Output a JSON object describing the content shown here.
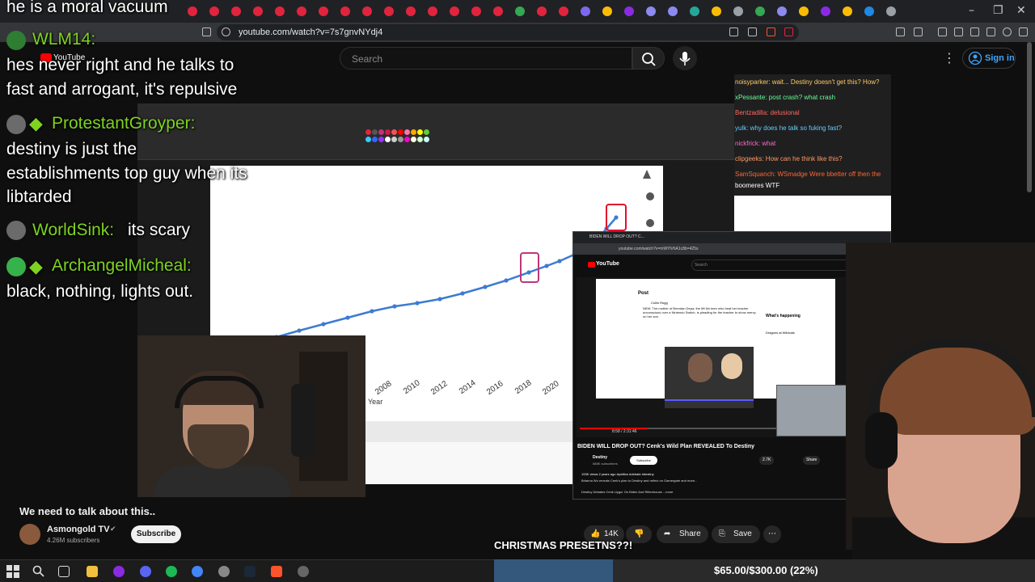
{
  "browser": {
    "url": "youtube.com/watch?v=7s7gnvNYdj4"
  },
  "youtube_header": {
    "search_placeholder": "Search",
    "sign_in": "Sign in",
    "logo_text": "YouTube"
  },
  "stream_chat": {
    "top_caption": "he is a moral vacuum",
    "messages": [
      {
        "user": "WLM14:",
        "lines": [
          "hes never right and he talks to",
          "fast and arrogant, it's repulsive"
        ]
      },
      {
        "user": "ProtestantGroyper:",
        "lines": [
          "destiny is just the",
          "establishments top guy when its",
          "libtarded"
        ]
      },
      {
        "user": "WorldSink:",
        "lines": [
          "its scary"
        ]
      },
      {
        "user": "ArchangelMicheal:",
        "lines": [
          "black, nothing, lights out."
        ]
      }
    ]
  },
  "chart_panel": {
    "x_ticks": [
      "2008",
      "2010",
      "2012",
      "2014",
      "2016",
      "2018",
      "2020"
    ],
    "x_label": "Year"
  },
  "overlay_chat": {
    "lines": [
      "noisyparker: wait... Destiny doesn't get this? How?",
      "xPessante: post crash? what crash",
      "Bentzadilla: delusional",
      "yulk: why does he talk so fuking fast?",
      "nickfrick: what",
      "clipgeeks: How can he think like this?",
      "SamSquanch: WSmadge Were bbetter off then the",
      "boomeres WTF"
    ]
  },
  "inner_browser": {
    "tab_title": "BIDEN WILL DROP OUT? C...",
    "url": "youtube.com/watch?v=mWYiVhA1c8b=425s",
    "logo": "YouTube",
    "search": "Search",
    "post_title": "Post",
    "post_user": "Collin Rugg",
    "post_body": "NEW: The mother of Brendan Depa, the 6ft 6in teen who beat her teacher unconscious over a Nintendo Switch, is pleading for the teacher to show mercy on her son.",
    "side_heading": "What's happening",
    "side_item": "Dragons at Wildcats",
    "playtime": "8:58 / 2:31:46",
    "video_title": "BIDEN WILL DROP OUT? Cenk's Wild Plan REVEALED To Destiny",
    "channel": "Destiny",
    "channel_subs": "888K subscribers",
    "subscribe": "Subscribe",
    "likes": "2.7K",
    "share": "Share",
    "views": "193K views  2 years ago  #politics #debate #destiny",
    "desc": "Brianna Wu reveals Cenk's plan to Destiny and reflect on Gamergate and more...",
    "more": "Destiny Debates Cenk Uygur On Biden And Rittenhouse  ...more"
  },
  "video_info": {
    "title": "We need to talk about this..",
    "channel": "Asmongold TV",
    "subs": "4.26M subscribers",
    "subscribe": "Subscribe",
    "likes": "14K",
    "share": "Share",
    "save": "Save"
  },
  "caption": "CHRISTMAS PRESETNS??!",
  "donation": {
    "text": "$65.00/$300.00 (22%)",
    "progress": 0.22
  },
  "colors": {
    "yt_bg": "#0f0f0f",
    "chat_username": "#7ed321",
    "chart_line": "#3c7bd3",
    "highlight_box": "#e0102f"
  }
}
